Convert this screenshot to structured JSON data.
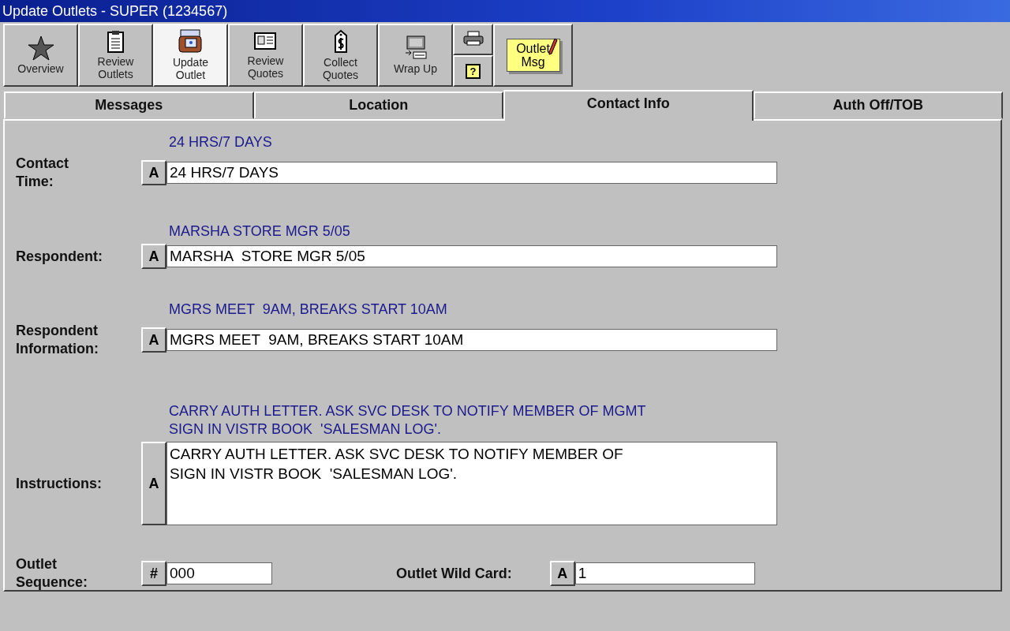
{
  "window": {
    "title": "Update Outlets -  SUPER (1234567)"
  },
  "toolbar": {
    "buttons": [
      {
        "kind": "star",
        "label": "Overview",
        "selected": false
      },
      {
        "kind": "clipboard",
        "label": "Review\nOutlets",
        "selected": false
      },
      {
        "kind": "machine",
        "label": "Update\nOutlet",
        "selected": true
      },
      {
        "kind": "document",
        "label": "Review\nQuotes",
        "selected": false
      },
      {
        "kind": "tag",
        "label": "Collect\nQuotes",
        "selected": false
      },
      {
        "kind": "computer",
        "label": "Wrap Up",
        "selected": false
      }
    ],
    "help_glyph": "?",
    "note": "Outlet\nMsg"
  },
  "tabs": [
    {
      "label": "Messages",
      "selected": false
    },
    {
      "label": "Location",
      "selected": false
    },
    {
      "label": "Contact Info",
      "selected": true
    },
    {
      "label": "Auth Off/TOB",
      "selected": false
    }
  ],
  "fields": [
    {
      "label": "Contact\nTime:",
      "hint": "24 HRS/7 DAYS",
      "button": "A",
      "value": "24 HRS/7 DAYS",
      "multiline": false
    },
    {
      "label": "Respondent:",
      "hint": "MARSHA STORE MGR 5/05",
      "button": "A",
      "value": "MARSHA  STORE MGR 5/05",
      "multiline": false
    },
    {
      "label": "Respondent\nInformation:",
      "hint": "MGRS MEET  9AM, BREAKS START 10AM",
      "button": "A",
      "value": "MGRS MEET  9AM, BREAKS START 10AM",
      "multiline": false
    },
    {
      "label": "Instructions:",
      "hint": "CARRY AUTH LETTER. ASK SVC DESK TO NOTIFY MEMBER OF MGMT\nSIGN IN VISTR BOOK  'SALESMAN LOG'.",
      "button": "A",
      "value": "CARRY AUTH LETTER. ASK SVC DESK TO NOTIFY MEMBER OF\nSIGN IN VISTR BOOK  'SALESMAN LOG'.",
      "multiline": true
    }
  ],
  "bottom_fields": [
    {
      "label": "Outlet\nSequence:",
      "button": "#",
      "value": "000"
    },
    {
      "label": "Outlet Wild Card:",
      "button": "A",
      "value": "1"
    }
  ]
}
